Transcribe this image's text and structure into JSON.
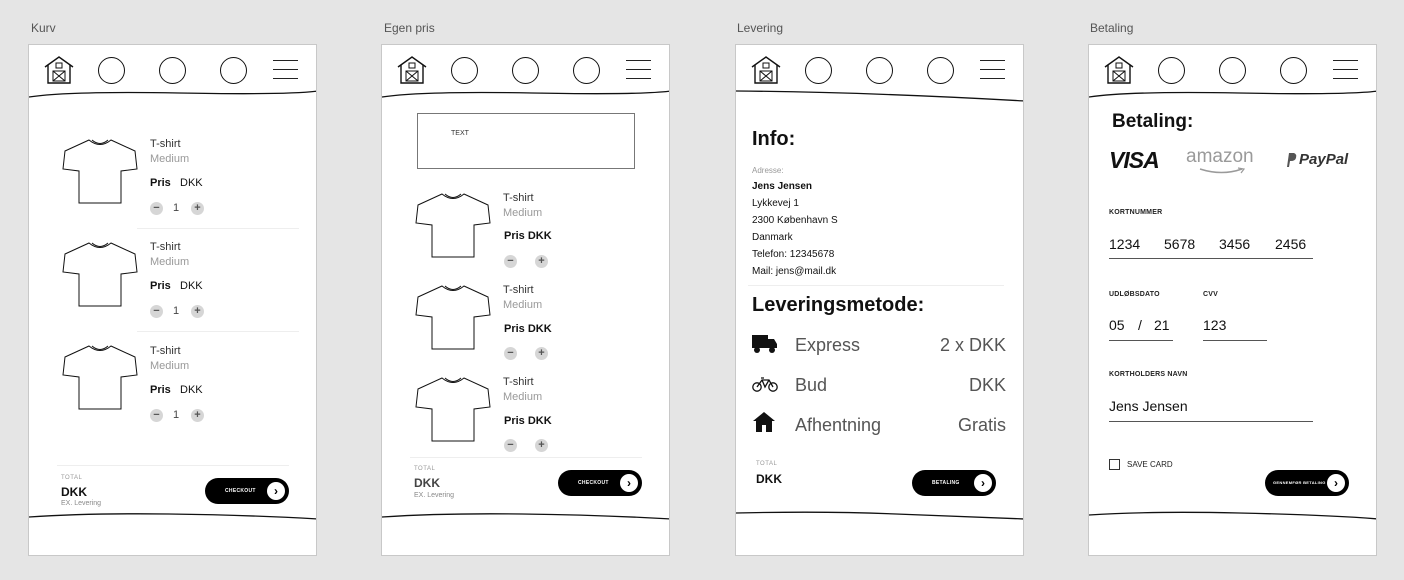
{
  "frames": {
    "kurv": "Kurv",
    "egenpris": "Egen pris",
    "levering": "Levering",
    "betaling": "Betaling"
  },
  "cart": {
    "items": [
      {
        "name": "T-shirt",
        "size": "Medium",
        "price_label": "Pris",
        "price_currency": "DKK",
        "qty": "1"
      },
      {
        "name": "T-shirt",
        "size": "Medium",
        "price_label": "Pris",
        "price_currency": "DKK",
        "qty": "1"
      },
      {
        "name": "T-shirt",
        "size": "Medium",
        "price_label": "Pris",
        "price_currency": "DKK",
        "qty": "1"
      }
    ],
    "total_label": "TOTAL",
    "total_value": "DKK",
    "total_note": "EX. Levering",
    "checkout_label": "CHECKOUT"
  },
  "custom_price": {
    "text_placeholder": "TEXT",
    "items": [
      {
        "name": "T-shirt",
        "size": "Medium",
        "price": "Pris DKK"
      },
      {
        "name": "T-shirt",
        "size": "Medium",
        "price": "Pris DKK"
      },
      {
        "name": "T-shirt",
        "size": "Medium",
        "price": "Pris DKK"
      }
    ],
    "total_label": "TOTAL",
    "total_value": "DKK",
    "total_note": "EX. Levering",
    "checkout_label": "CHECKOUT"
  },
  "delivery": {
    "info_title": "Info:",
    "address_label": "Adresse:",
    "name": "Jens Jensen",
    "street": "Lykkevej 1",
    "city": "2300 København S",
    "country": "Danmark",
    "phone": "Telefon: 12345678",
    "mail": "Mail: jens@mail.dk",
    "methods_title": "Leveringsmetode:",
    "methods": [
      {
        "label": "Express",
        "price": "2 x DKK",
        "icon": "truck-icon"
      },
      {
        "label": "Bud",
        "price": "DKK",
        "icon": "bicycle-icon"
      },
      {
        "label": "Afhentning",
        "price": "Gratis",
        "icon": "house-icon"
      }
    ],
    "total_label": "TOTAL",
    "total_value": "DKK",
    "pay_label": "BETALING"
  },
  "payment": {
    "title": "Betaling:",
    "providers": {
      "visa": "VISA",
      "amazon": "amazon",
      "paypal": "PayPal"
    },
    "card_number_label": "KORTNUMMER",
    "card_number": [
      "1234",
      "5678",
      "3456",
      "2456"
    ],
    "expiry_label": "UDLØBSDATO",
    "expiry_month": "05",
    "expiry_sep": "/",
    "expiry_year": "21",
    "cvv_label": "CVV",
    "cvv": "123",
    "holder_label": "KORTHOLDERS NAVN",
    "holder": "Jens Jensen",
    "save_card_label": "SAVE CARD",
    "confirm_label": "GENNEMFØR BETALING"
  },
  "colors": {
    "accent": "#000000",
    "muted": "#999999",
    "stepper": "#d6d6d6",
    "paypal": "#333333"
  }
}
